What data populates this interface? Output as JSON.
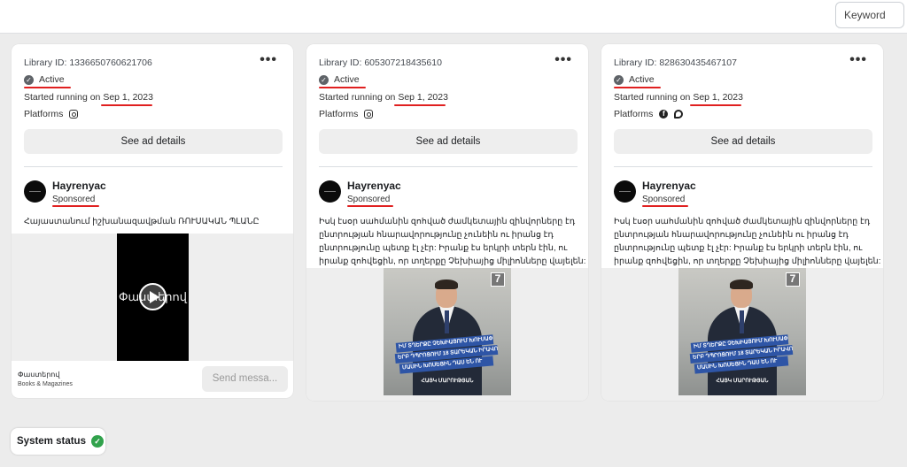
{
  "search": {
    "placeholder": "Keyword"
  },
  "cards": [
    {
      "library_id": "Library ID: 1336650760621706",
      "status": "Active",
      "started_prefix": "Started running on ",
      "started_date": "Sep 1, 2023",
      "platforms_label": "Platforms",
      "platform_icons": [
        "instagram-icon"
      ],
      "details_label": "See ad details",
      "page_name": "Hayrenyac",
      "sponsored": "Sponsored",
      "body_lines": [
        "Հայաստանում իշխանազավթման ՌՈՒՍԱԿԱՆ ՊԼԱՆԸ"
      ],
      "video_text": "Փաստերով",
      "cta_title": "Փաստերով",
      "cta_subtitle": "Books & Magazines",
      "cta_button": "Send messa..."
    },
    {
      "library_id": "Library ID: 605307218435610",
      "status": "Active",
      "started_prefix": "Started running on ",
      "started_date": "Sep 1, 2023",
      "platforms_label": "Platforms",
      "platform_icons": [
        "instagram-icon"
      ],
      "details_label": "See ad details",
      "page_name": "Hayrenyac",
      "sponsored": "Sponsored",
      "body_lines": [
        "Իսկ էսօր սահմանին զոհված ժամկետային զինվորները էդ",
        "ընտրության հնարավորությունը չունեին ու իրանց էդ",
        "ընտրությունը պետք էլ չէր: Իրանք էս երկրի տերն էին, ու",
        "իրանք զոհվեցին, որ տղերքը Չեխիայից միլիոնները վայելեն:"
      ],
      "poster_logo": "7",
      "poster_lines": [
        "ԻՄ ՏՂԵՐՔԸ ՉԵԽԻԱՅՈՒՄ ԽՈՒՍԱՓԵՑԻՆ ԵՆ,",
        "ԵՐԲ ԴՊՐՈՑՈՒՄ 18 ՏԱՐԵԿԱՆ ԻՐԱՎՈՒՆՔՆԵՐԻ",
        "ՄԱՍԻՆ ԽՈՍԵՑԻՆ ԴԱՍ ԵՆ ՈՒ"
      ],
      "poster_caption": "ՀԱՅԿ ՄԱՐՈՒԹՅԱՆ"
    },
    {
      "library_id": "Library ID: 828630435467107",
      "status": "Active",
      "started_prefix": "Started running on ",
      "started_date": "Sep 1, 2023",
      "platforms_label": "Platforms",
      "platform_icons": [
        "facebook-icon",
        "messenger-icon"
      ],
      "details_label": "See ad details",
      "page_name": "Hayrenyac",
      "sponsored": "Sponsored",
      "body_lines": [
        "Իսկ էսօր սահմանին զոհված ժամկետային զինվորները էդ",
        "ընտրության հնարավորությունը չունեին ու իրանց էդ",
        "ընտրությունը պետք էլ չէր: Իրանք էս երկրի տերն էին, ու",
        "իրանք զոհվեցին, որ տղերքը Չեխիայից միլիոնները վայելեն:"
      ],
      "poster_logo": "7",
      "poster_lines": [
        "ԻՄ ՏՂԵՐՔԸ ՉԵԽԻԱՅՈՒՄ ԽՈՒՍԱՓԵՑԻՆ ԵՆ,",
        "ԵՐԲ ԴՊՐՈՑՈՒՄ 18 ՏԱՐԵԿԱՆ ԻՐԱՎՈՒՆՔՆԵՐԻ",
        "ՄԱՍԻՆ ԽՈՍԵՑԻՆ ԴԱՍ ԵՆ ՈՒ"
      ],
      "poster_caption": "ՀԱՅԿ ՄԱՐՈՒԹՅԱՆ"
    }
  ],
  "system_status": {
    "label": "System status"
  },
  "colors": {
    "annotation_red": "#e02020",
    "status_green": "#31a24c"
  }
}
